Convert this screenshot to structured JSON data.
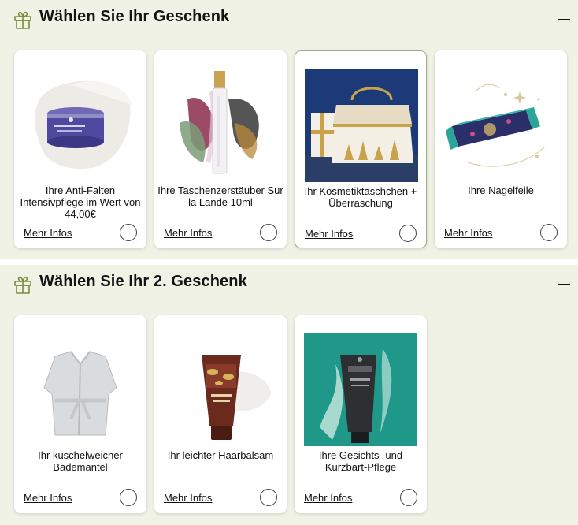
{
  "sections": [
    {
      "title": "Wählen Sie Ihr Geschenk",
      "items": [
        {
          "title": "Ihre Anti-Falten Intensivpflege im Wert von 44,00€",
          "link": "Mehr Infos"
        },
        {
          "title": "Ihre Taschenzerstäuber Sur la Lande 10ml",
          "link": "Mehr Infos"
        },
        {
          "title": "Ihr Kosmetiktäschchen + Überraschung",
          "link": "Mehr Infos"
        },
        {
          "title": "Ihre Nagelfeile",
          "link": "Mehr Infos"
        }
      ]
    },
    {
      "title": "Wählen Sie Ihr 2. Geschenk",
      "items": [
        {
          "title": "Ihr kuschelweicher Bademantel",
          "link": "Mehr Infos"
        },
        {
          "title": "Ihr leichter Haarbalsam",
          "link": "Mehr Infos"
        },
        {
          "title": "Ihre Gesichts- und Kurzbart-Pflege",
          "link": "Mehr Infos"
        }
      ]
    }
  ],
  "colors": {
    "background": "#f1f2e6",
    "card": "#ffffff",
    "icon_green": "#7a8c3c",
    "text": "#111111"
  },
  "icons": {
    "section": "gift-icon",
    "toggle": "minus-icon"
  }
}
